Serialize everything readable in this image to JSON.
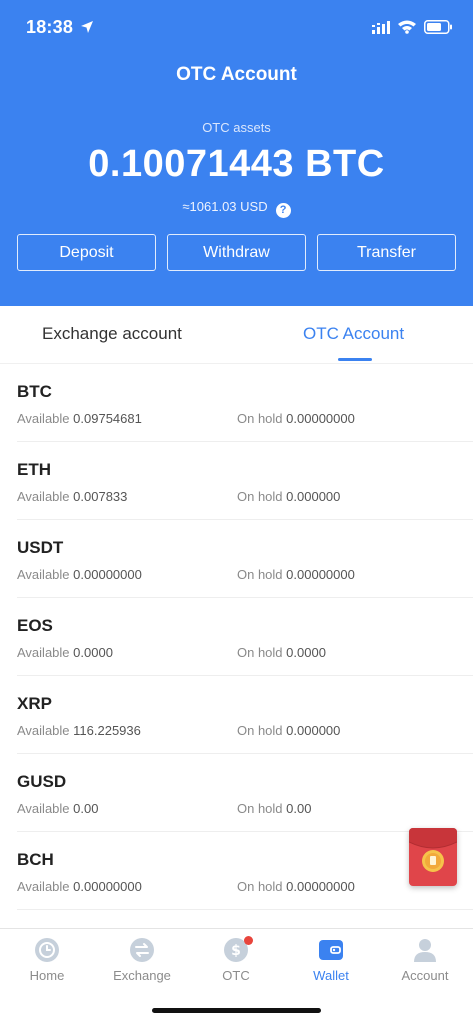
{
  "status_bar": {
    "time": "18:38"
  },
  "header": {
    "title": "OTC Account",
    "assets_label": "OTC assets",
    "assets_value": "0.10071443 BTC",
    "usd_equivalent": "≈1061.03 USD",
    "help": "?",
    "buttons": {
      "deposit": "Deposit",
      "withdraw": "Withdraw",
      "transfer": "Transfer"
    },
    "background_color": "#3b82f0"
  },
  "tabs": [
    {
      "label": "Exchange account",
      "active": false
    },
    {
      "label": "OTC Account",
      "active": true
    }
  ],
  "labels": {
    "available": "Available",
    "on_hold": "On hold"
  },
  "assets": [
    {
      "name": "BTC",
      "available": "0.09754681",
      "on_hold": "0.00000000"
    },
    {
      "name": "ETH",
      "available": "0.007833",
      "on_hold": "0.000000"
    },
    {
      "name": "USDT",
      "available": "0.00000000",
      "on_hold": "0.00000000"
    },
    {
      "name": "EOS",
      "available": "0.0000",
      "on_hold": "0.0000"
    },
    {
      "name": "XRP",
      "available": "116.225936",
      "on_hold": "0.000000"
    },
    {
      "name": "GUSD",
      "available": "0.00",
      "on_hold": "0.00"
    },
    {
      "name": "BCH",
      "available": "0.00000000",
      "on_hold": "0.00000000"
    }
  ],
  "bottom_nav": [
    {
      "label": "Home",
      "icon": "clock-icon",
      "active": false
    },
    {
      "label": "Exchange",
      "icon": "swap-icon",
      "active": false
    },
    {
      "label": "OTC",
      "icon": "dollar-icon",
      "active": false,
      "badge": true
    },
    {
      "label": "Wallet",
      "icon": "wallet-icon",
      "active": true
    },
    {
      "label": "Account",
      "icon": "person-icon",
      "active": false
    }
  ],
  "colors": {
    "accent": "#3b82f0",
    "badge": "#e8453c",
    "red_envelope": "#e0454a"
  }
}
